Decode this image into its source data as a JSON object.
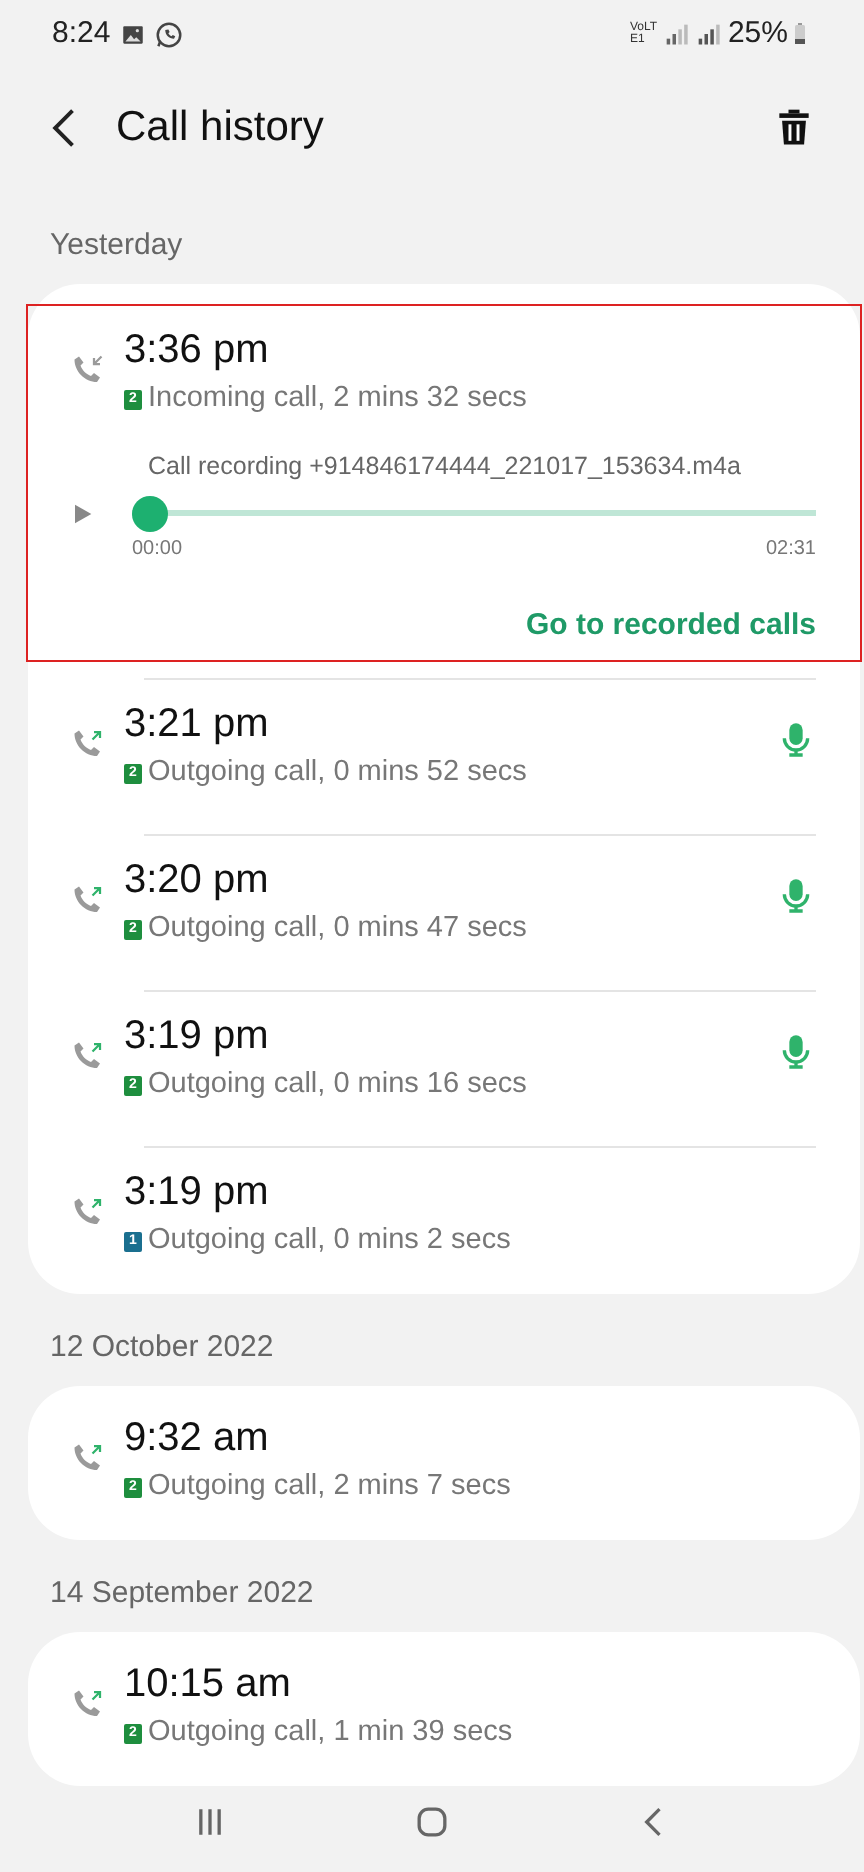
{
  "status_bar": {
    "time": "8:24",
    "network": "VoLTE1",
    "battery": "25%"
  },
  "header": {
    "title": "Call history"
  },
  "groups": [
    {
      "date": "Yesterday",
      "calls": [
        {
          "time": "3:36 pm",
          "kind": "incoming",
          "sim": "2",
          "color": "#1e8e3e",
          "detail": "Incoming call, 2 mins 32 secs",
          "recorded": false,
          "recording": {
            "file": "Call recording +914846174444_221017_153634.m4a",
            "level": 0,
            "start": "00:00",
            "end": "02:31",
            "link": "Go to recorded calls"
          }
        },
        {
          "time": "3:21 pm",
          "kind": "outgoing",
          "sim": "2",
          "color": "#1e8e3e",
          "detail": "Outgoing call, 0 mins 52 secs",
          "recorded": true
        },
        {
          "time": "3:20 pm",
          "kind": "outgoing",
          "sim": "2",
          "color": "#1e8e3e",
          "detail": "Outgoing call, 0 mins 47 secs",
          "recorded": true
        },
        {
          "time": "3:19 pm",
          "kind": "outgoing",
          "sim": "2",
          "color": "#1e8e3e",
          "detail": "Outgoing call, 0 mins 16 secs",
          "recorded": true
        },
        {
          "time": "3:19 pm",
          "kind": "outgoing",
          "sim": "1",
          "color": "#1a6f8f",
          "detail": "Outgoing call, 0 mins 2 secs",
          "recorded": false
        }
      ]
    },
    {
      "date": "12 October 2022",
      "calls": [
        {
          "time": "9:32 am",
          "kind": "outgoing",
          "sim": "2",
          "color": "#1e8e3e",
          "detail": "Outgoing call, 2 mins 7 secs",
          "recorded": false
        }
      ]
    },
    {
      "date": "14 September 2022",
      "calls": [
        {
          "time": "10:15 am",
          "kind": "outgoing",
          "sim": "2",
          "color": "#1e8e3e",
          "detail": "Outgoing call, 1 min 39 secs",
          "recorded": false
        }
      ]
    }
  ]
}
